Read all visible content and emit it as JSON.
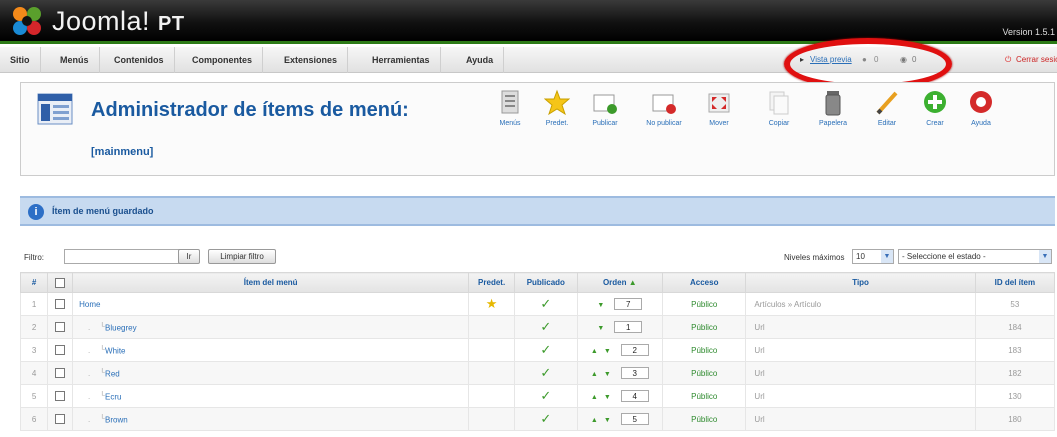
{
  "header": {
    "logo_text": "Joomla!",
    "logo_suffix": "PT",
    "version": "Version 1.5.1"
  },
  "menubar": {
    "items": [
      "Sitio",
      "Menús",
      "Contenidos",
      "Componentes",
      "Extensiones",
      "Herramientas",
      "Ayuda"
    ],
    "preview": "Vista previa",
    "counter1": "0",
    "counter2": "0",
    "logout": "Cerrar sesión"
  },
  "toolbar": {
    "title": "Administrador de ítems de menú:",
    "subtitle": "[mainmenu]",
    "buttons": [
      {
        "label": "Menús",
        "icon": "menus-icon"
      },
      {
        "label": "Predet.",
        "icon": "star-icon"
      },
      {
        "label": "Publicar",
        "icon": "publish-icon"
      },
      {
        "label": "No publicar",
        "icon": "unpublish-icon"
      },
      {
        "label": "Mover",
        "icon": "move-icon"
      },
      {
        "label": "Copiar",
        "icon": "copy-icon"
      },
      {
        "label": "Papelera",
        "icon": "trash-icon"
      },
      {
        "label": "Editar",
        "icon": "edit-icon"
      },
      {
        "label": "Crear",
        "icon": "new-icon"
      },
      {
        "label": "Ayuda",
        "icon": "help-icon"
      }
    ]
  },
  "message": "Ítem de menú guardado",
  "filter": {
    "label": "Filtro:",
    "value": "",
    "go_label": "Ir",
    "reset_label": "Limpiar filtro",
    "levels_label": "Niveles máximos",
    "levels_value": "10",
    "state_value": "- Seleccione el estado -"
  },
  "table": {
    "headers": [
      "#",
      "",
      "Ítem del menú",
      "Predet.",
      "Publicado",
      "Orden",
      "Acceso",
      "Tipo",
      "ID del ítem"
    ],
    "rows": [
      {
        "num": "1",
        "name": "Home",
        "default": true,
        "order": "7",
        "access": "Público",
        "type": "Artículos » Artículo",
        "id": "53",
        "up": false,
        "down": true
      },
      {
        "num": "2",
        "name": "Bluegrey",
        "default": false,
        "order": "1",
        "access": "Público",
        "type": "Url",
        "id": "184",
        "up": false,
        "down": true
      },
      {
        "num": "3",
        "name": "White",
        "default": false,
        "order": "2",
        "access": "Público",
        "type": "Url",
        "id": "183",
        "up": true,
        "down": true
      },
      {
        "num": "4",
        "name": "Red",
        "default": false,
        "order": "3",
        "access": "Público",
        "type": "Url",
        "id": "182",
        "up": true,
        "down": true
      },
      {
        "num": "5",
        "name": "Ecru",
        "default": false,
        "order": "4",
        "access": "Público",
        "type": "Url",
        "id": "130",
        "up": true,
        "down": true
      },
      {
        "num": "6",
        "name": "Brown",
        "default": false,
        "order": "5",
        "access": "Público",
        "type": "Url",
        "id": "180",
        "up": true,
        "down": true
      }
    ]
  }
}
